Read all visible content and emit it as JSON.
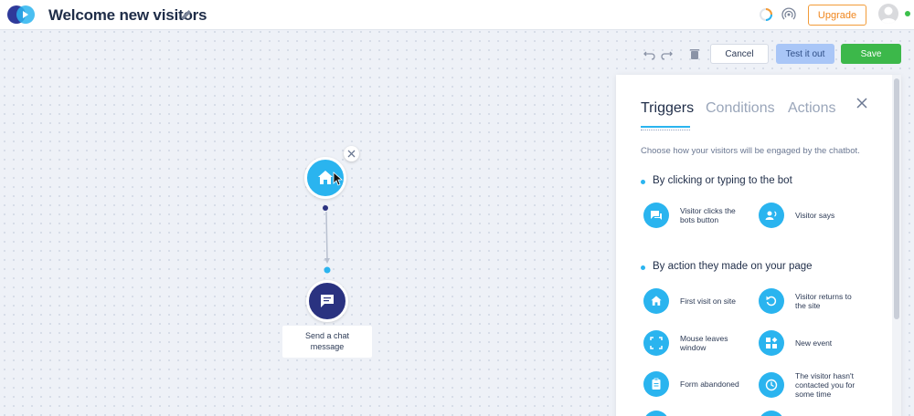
{
  "header": {
    "title": "Welcome new visitors",
    "upgrade_label": "Upgrade",
    "icons": [
      "logo-icon",
      "edit-icon",
      "loader-icon",
      "signal-icon",
      "avatar",
      "status-dot"
    ],
    "colors": {
      "accent": "#2ab4ef",
      "upgrade": "#f29b38",
      "online": "#3cc04b"
    }
  },
  "toolbar": {
    "cancel_label": "Cancel",
    "test_label": "Test it out",
    "save_label": "Save",
    "icons": [
      "undo-icon",
      "redo-icon",
      "trash-icon"
    ]
  },
  "flow": {
    "trigger_icon": "home-icon",
    "action_icon": "chat-message-icon",
    "action_caption_line1": "Send a chat",
    "action_caption_line2": "message"
  },
  "panel": {
    "tabs": [
      {
        "label": "Triggers",
        "active": true
      },
      {
        "label": "Conditions",
        "active": false
      },
      {
        "label": "Actions",
        "active": false
      }
    ],
    "description": "Choose how your visitors will be engaged by the chatbot.",
    "sections": [
      {
        "title": "By clicking or typing to the bot",
        "options": [
          {
            "label": "Visitor clicks the bots button",
            "icon": "chat-bubbles-icon"
          },
          {
            "label": "Visitor says",
            "icon": "person-speaking-icon"
          }
        ]
      },
      {
        "title": "By action they made on your page",
        "options": [
          {
            "label": "First visit on site",
            "icon": "home-icon"
          },
          {
            "label": "Visitor returns to the site",
            "icon": "return-icon"
          },
          {
            "label": "Mouse leaves window",
            "icon": "fullscreen-icon"
          },
          {
            "label": "New event",
            "icon": "widgets-icon"
          },
          {
            "label": "Form abandoned",
            "icon": "clipboard-icon"
          },
          {
            "label": "The visitor hasn't contacted you for some time",
            "icon": "clock-icon"
          }
        ]
      }
    ]
  }
}
